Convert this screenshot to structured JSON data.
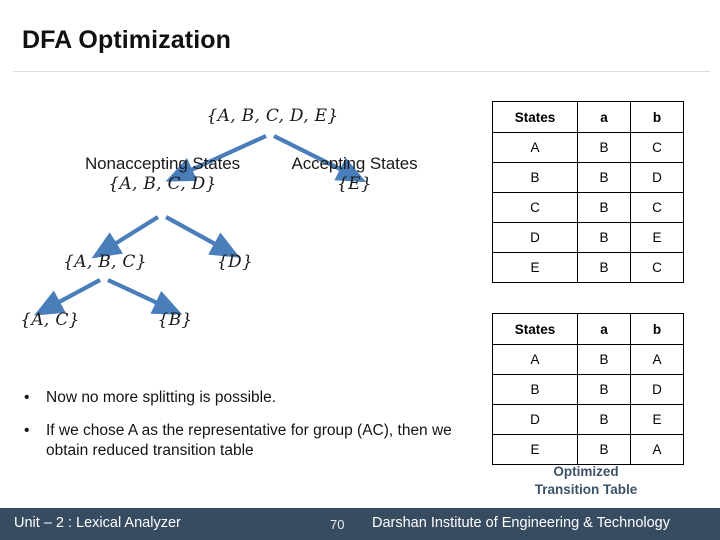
{
  "slide": {
    "title": "DFA Optimization",
    "page_number": "70"
  },
  "tree": {
    "arrow_color": "#4a7ebb",
    "nodes": {
      "root": "{A, B, C, D, E}",
      "nonaccepting_label": "Nonaccepting States",
      "nonaccepting_set": "{A, B, C, D}",
      "accepting_label": "Accepting States",
      "accepting_set": "{E}",
      "abc": "{A, B, C}",
      "d": "{D}",
      "ac": "{A, C}",
      "b": "{B}"
    }
  },
  "bullets": [
    {
      "marker": "•",
      "text": "Now no more splitting is possible."
    },
    {
      "marker": "•",
      "text": "If we chose A as the representative for group (AC), then we obtain reduced transition table"
    }
  ],
  "tables": {
    "original": {
      "headers": [
        "States",
        "a",
        "b"
      ],
      "rows": [
        [
          "A",
          "B",
          "C"
        ],
        [
          "B",
          "B",
          "D"
        ],
        [
          "C",
          "B",
          "C"
        ],
        [
          "D",
          "B",
          "E"
        ],
        [
          "E",
          "B",
          "C"
        ]
      ]
    },
    "optimized": {
      "headers": [
        "States",
        "a",
        "b"
      ],
      "rows": [
        [
          "A",
          "B",
          "A"
        ],
        [
          "B",
          "B",
          "D"
        ],
        [
          "D",
          "B",
          "E"
        ],
        [
          "E",
          "B",
          "A"
        ]
      ],
      "caption_line1": "Optimized",
      "caption_line2": "Transition Table",
      "caption_color": "#3b5268"
    }
  },
  "footer": {
    "left_text": "Unit – 2 : Lexical Analyzer",
    "page_number": "70",
    "right_text": "Darshan Institute of Engineering & Technology",
    "background": "#374c61"
  }
}
